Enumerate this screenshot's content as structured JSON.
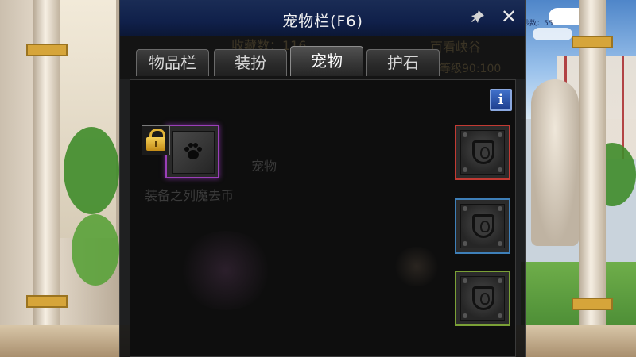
{
  "window": {
    "title": "宠物栏(F6)",
    "pin_icon": "pin-icon",
    "close_icon": "close-icon",
    "close_glyph": "✕",
    "pin_glyph": "📌"
  },
  "tabs": [
    {
      "label": "物品栏",
      "active": false
    },
    {
      "label": "装扮",
      "active": false
    },
    {
      "label": "宠物",
      "active": true
    },
    {
      "label": "护石",
      "active": false
    }
  ],
  "background_text": {
    "behind_tabs_left": "收藏数：116",
    "behind_tabs_right": "百看峡谷",
    "behind_tabs_level": "等级90:100",
    "top_right_banner": "秒数：55"
  },
  "panel": {
    "info_label": "i",
    "pet_slot": {
      "icon": "paw-icon",
      "glyph": "🐾",
      "locked": true,
      "border_color": "#9a3fb8"
    },
    "lock_icon": "lock-icon",
    "faded_text_1": "宠物",
    "faded_text_2": "装备之列魔去币",
    "equip_slots": [
      {
        "name": "red",
        "border_color": "#c23a33"
      },
      {
        "name": "blue",
        "border_color": "#3e7fb8"
      },
      {
        "name": "green",
        "border_color": "#7aa036"
      }
    ]
  },
  "colors": {
    "title_bar": "#10204a",
    "panel_bg": "#0e0e0e",
    "info_button": "#1e3f8e"
  }
}
